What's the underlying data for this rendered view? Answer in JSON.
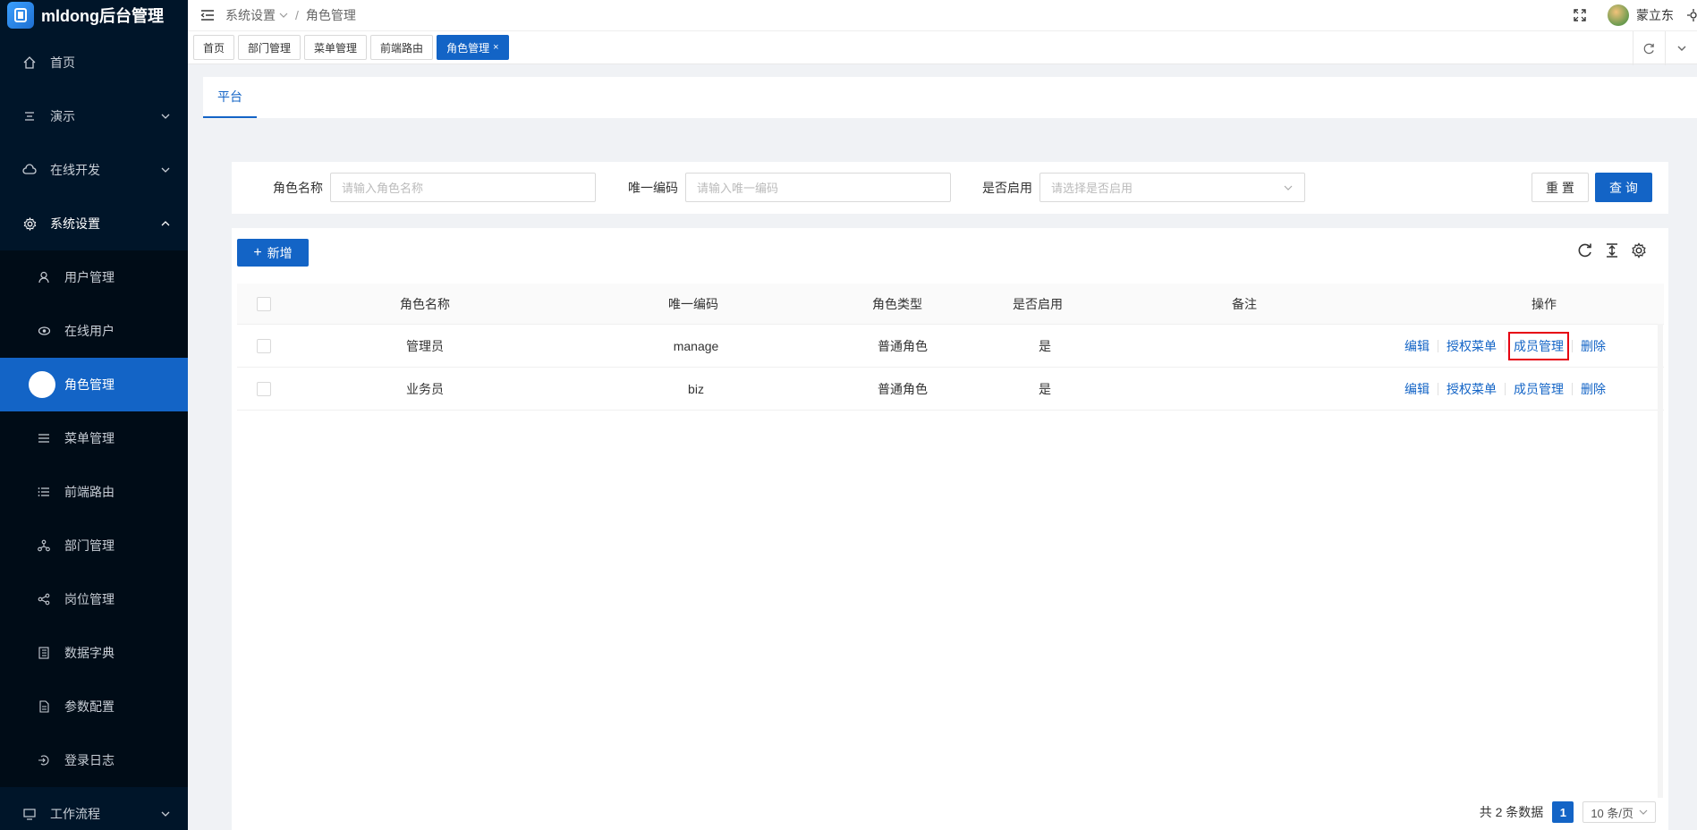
{
  "app": {
    "title": "mldong后台管理"
  },
  "sidebar": {
    "items": [
      {
        "label": "首页",
        "icon": "home-icon"
      },
      {
        "label": "演示",
        "icon": "demo-icon"
      },
      {
        "label": "在线开发",
        "icon": "cloud-icon"
      },
      {
        "label": "系统设置",
        "icon": "settings-icon"
      }
    ],
    "submenu": [
      {
        "label": "用户管理",
        "icon": "user-icon"
      },
      {
        "label": "在线用户",
        "icon": "online-icon"
      },
      {
        "label": "角色管理",
        "icon": "role-icon"
      },
      {
        "label": "菜单管理",
        "icon": "menu-icon"
      },
      {
        "label": "前端路由",
        "icon": "route-icon"
      },
      {
        "label": "部门管理",
        "icon": "org-icon"
      },
      {
        "label": "岗位管理",
        "icon": "share-icon"
      },
      {
        "label": "数据字典",
        "icon": "book-icon"
      },
      {
        "label": "参数配置",
        "icon": "file-icon"
      },
      {
        "label": "登录日志",
        "icon": "login-icon"
      }
    ],
    "footer_item": {
      "label": "工作流程",
      "icon": "desktop-icon"
    }
  },
  "header": {
    "breadcrumb": [
      "系统设置",
      "角色管理"
    ],
    "username": "蒙立东"
  },
  "tabs": [
    {
      "label": "首页"
    },
    {
      "label": "部门管理"
    },
    {
      "label": "菜单管理"
    },
    {
      "label": "前端路由"
    },
    {
      "label": "角色管理",
      "close": "×"
    }
  ],
  "platform_tab": "平台",
  "search": {
    "role_name_label": "角色名称",
    "role_name_placeholder": "请输入角色名称",
    "code_label": "唯一编码",
    "code_placeholder": "请输入唯一编码",
    "enabled_label": "是否启用",
    "enabled_placeholder": "请选择是否启用",
    "reset_label": "重 置",
    "query_label": "查 询"
  },
  "table": {
    "add_label": "新增",
    "columns": [
      "角色名称",
      "唯一编码",
      "角色类型",
      "是否启用",
      "备注",
      "操作"
    ],
    "rows": [
      {
        "name": "管理员",
        "code": "manage",
        "type": "普通角色",
        "enabled": "是",
        "remark": ""
      },
      {
        "name": "业务员",
        "code": "biz",
        "type": "普通角色",
        "enabled": "是",
        "remark": ""
      }
    ],
    "actions": [
      "编辑",
      "授权菜单",
      "成员管理",
      "删除"
    ]
  },
  "pagination": {
    "total_text": "共 2 条数据",
    "current_page": "1",
    "page_size": "10 条/页"
  },
  "colors": {
    "primary": "#1364c6",
    "sidebar_bg": "#001529",
    "highlight": "#e60012"
  }
}
